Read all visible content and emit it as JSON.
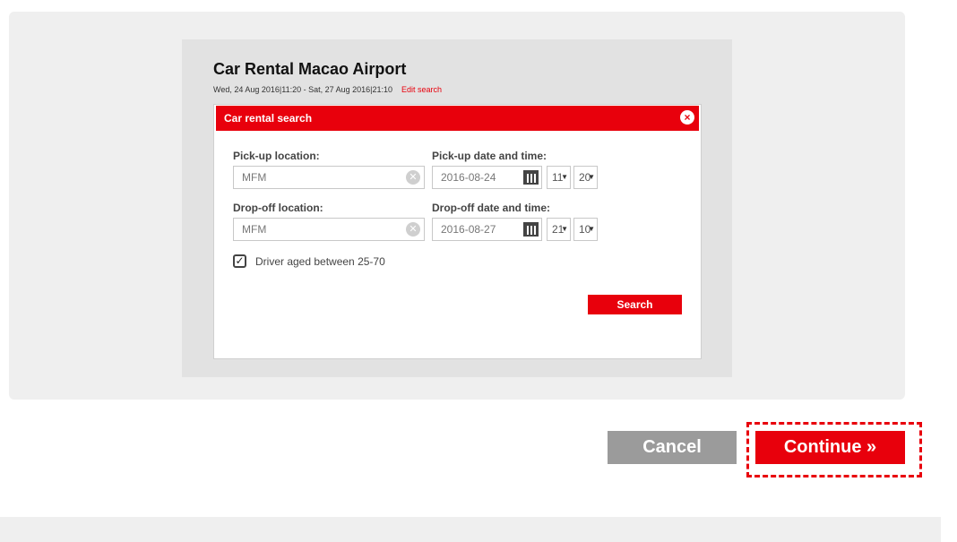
{
  "page": {
    "title": "Car Rental Macao Airport",
    "dates": "Wed, 24 Aug 2016|11:20 - Sat, 27 Aug 2016|21:10",
    "edit_link": "Edit search"
  },
  "dialog": {
    "title": "Car rental search",
    "close_icon": "×",
    "pickup_location_label": "Pick-up location:",
    "pickup_location_value": "MFM",
    "pickup_datetime_label": "Pick-up date and time:",
    "pickup_date": "2016-08-24",
    "pickup_hour": "11",
    "pickup_minute": "20",
    "dropoff_location_label": "Drop-off location:",
    "dropoff_location_value": "MFM",
    "dropoff_datetime_label": "Drop-off date and time:",
    "dropoff_date": "2016-08-27",
    "dropoff_hour": "21",
    "dropoff_minute": "10",
    "driver_age_label": "Driver aged between 25-70",
    "driver_age_checked": true,
    "search_button": "Search"
  },
  "actions": {
    "cancel": "Cancel",
    "continue": "Continue »"
  },
  "colors": {
    "accent": "#e8000c",
    "cancel_bg": "#9b9b9b"
  },
  "icons": {
    "clear": "clear-icon",
    "calendar": "calendar-icon",
    "close": "close-icon",
    "check": "checkmark-icon"
  }
}
